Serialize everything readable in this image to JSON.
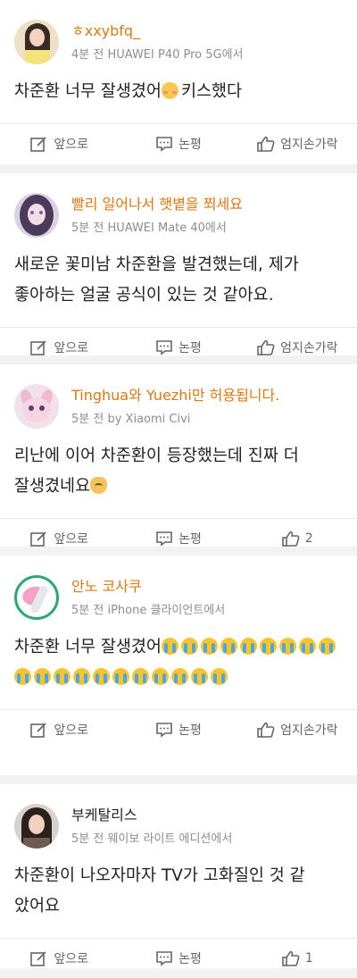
{
  "posts": [
    {
      "username": "ㅎxxybfq_",
      "time": "4분 전",
      "source": "HUAWEI P40 Pro 5G에서",
      "text_lines": [
        "차준환 너무 잘생겼어",
        "키스했다"
      ],
      "emoji": "shy-face",
      "actions": {
        "repost": "앞으로",
        "comment": "논평",
        "like": "엄지손가락"
      }
    },
    {
      "username": "빨리 일어나서 햇볕을 쬐세요",
      "time": "5분 전",
      "source": "HUAWEI Mate 40에서",
      "text_lines": [
        "새로운 꽃미남 차준환을 발견했는데, 제가",
        "좋아하는 얼굴 공식이 있는 것 같아요."
      ],
      "actions": {
        "repost": "앞으로",
        "comment": "논평",
        "like": "엄지손가락"
      }
    },
    {
      "username": "Tinghua와 Yuezhi만 허용됩니다.",
      "time": "5분 전",
      "source": "by Xiaomi Civi",
      "text_lines": [
        "리난에 이어 차준환이 등장했는데 진짜 더",
        "잘생겼네요"
      ],
      "emoji": "cat-face",
      "actions": {
        "repost": "앞으로",
        "comment": "논평",
        "like": "2"
      }
    },
    {
      "username": "안노 코사쿠",
      "time": "5분 전",
      "source": "iPhone 클라이언트에서",
      "text_lines": [
        "차준환 너무 잘생겼어"
      ],
      "emoji": "crying-face",
      "actions": {
        "repost": "앞으로",
        "comment": "논평",
        "like": "엄지손가락"
      }
    },
    {
      "username": "부케탈리스",
      "time": "5분 전",
      "source": "웨이보 라이트 에디션에서",
      "text_lines": [
        "차준환이 나오자마자 TV가 고화질인 것 같",
        "았어요"
      ],
      "actions": {
        "repost": "앞으로",
        "comment": "논평",
        "like": "1"
      }
    }
  ]
}
